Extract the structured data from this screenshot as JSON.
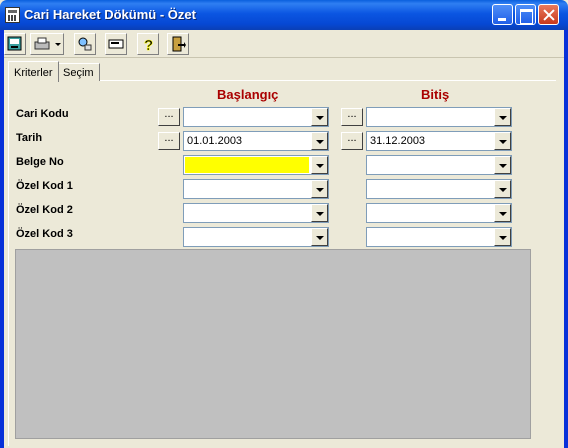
{
  "window": {
    "title": "Cari Hareket Dökümü - Özet"
  },
  "toolbar": {
    "icons": [
      "preview-icon",
      "printer-icon",
      "find-icon",
      "tray-icon",
      "help-icon",
      "exit-door-icon"
    ]
  },
  "tabs": [
    {
      "label": "Kriterler",
      "active": true
    },
    {
      "label": "Seçim",
      "active": false
    }
  ],
  "columns": {
    "start": "Başlangıç",
    "end": "Bitiş"
  },
  "rows": [
    {
      "label": "Cari Kodu",
      "start": "",
      "end": ""
    },
    {
      "label": "Tarih",
      "start": "01.01.2003",
      "end": "31.12.2003"
    },
    {
      "label": "Belge No",
      "start": "",
      "end": ""
    },
    {
      "label": "Özel Kod 1",
      "start": "",
      "end": ""
    },
    {
      "label": "Özel Kod 2",
      "start": "",
      "end": ""
    },
    {
      "label": "Özel Kod 3",
      "start": "",
      "end": ""
    }
  ],
  "browse_label": "...",
  "colors": {
    "highlight_field": "#ffff00",
    "header_red": "#aa0000"
  }
}
